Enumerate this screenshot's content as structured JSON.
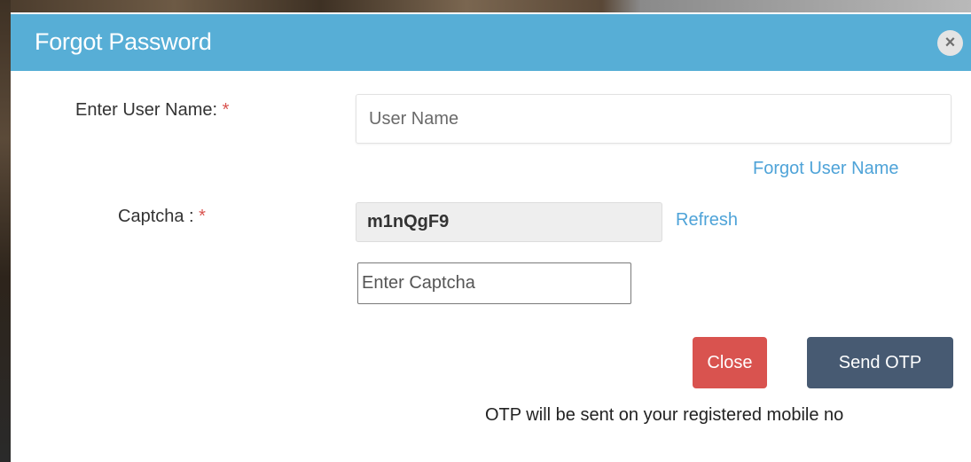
{
  "modal": {
    "title": "Forgot Password",
    "close_icon": "×"
  },
  "form": {
    "username_label": "Enter User Name:",
    "required_mark": "*",
    "username_placeholder": "User Name",
    "forgot_username_link": "Forgot User Name",
    "captcha_label": "Captcha :",
    "captcha_value": "m1nQgF9",
    "refresh_link": "Refresh",
    "captcha_placeholder": "Enter Captcha"
  },
  "actions": {
    "close_label": "Close",
    "send_otp_label": "Send OTP"
  },
  "note": "OTP will be sent on your registered mobile no",
  "colors": {
    "header": "#57aed6",
    "close_button": "#d9534f",
    "send_button": "#475a72",
    "link": "#4ea3d8"
  }
}
